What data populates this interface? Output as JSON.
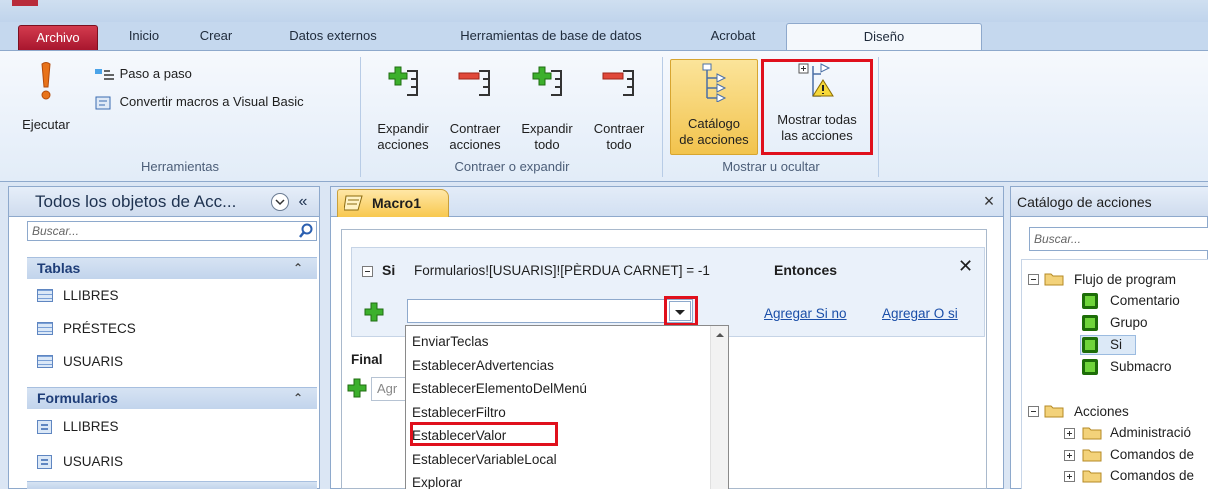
{
  "tabs": {
    "file": "Archivo",
    "home": "Inicio",
    "create": "Crear",
    "external": "Datos externos",
    "dbtools": "Herramientas de base de datos",
    "acrobat": "Acrobat",
    "design": "Diseño"
  },
  "ribbon": {
    "run": "Ejecutar",
    "step": "Paso a paso",
    "convert": "Convertir macros a Visual Basic",
    "tools_group": "Herramientas",
    "expand_actions_1": "Expandir",
    "expand_actions_2": "acciones",
    "collapse_actions_1": "Contraer",
    "collapse_actions_2": "acciones",
    "expand_all_1": "Expandir",
    "expand_all_2": "todo",
    "collapse_all_1": "Contraer",
    "collapse_all_2": "todo",
    "collapse_group": "Contraer o expandir",
    "catalog_1": "Catálogo",
    "catalog_2": "de acciones",
    "show_all_1": "Mostrar todas",
    "show_all_2": "las acciones",
    "show_group": "Mostrar u ocultar"
  },
  "nav": {
    "title": "Todos los objetos de Acc...",
    "collapse": "«",
    "search_placeholder": "Buscar...",
    "groups": [
      {
        "label": "Tablas",
        "items": [
          "LLIBRES",
          "PRÉSTECS",
          "USUARIS"
        ]
      },
      {
        "label": "Formularios",
        "items": [
          "LLIBRES",
          "USUARIS"
        ]
      }
    ]
  },
  "document": {
    "tab": "Macro1",
    "close": "×",
    "if_keyword": "Si",
    "condition": "Formularios![USUARIS]![PÈRDUA CARNET] = -1",
    "then_keyword": "Entonces",
    "add_else": "Agregar Si no",
    "add_else_if": "Agregar O si",
    "final_label": "Final",
    "add_new_placeholder": "Agr",
    "dropdown_items": [
      "EnviarTeclas",
      "EstablecerAdvertencias",
      "EstablecerElementoDelMenú",
      "EstablecerFiltro",
      "EstablecerValor",
      "EstablecerVariableLocal",
      "Explorar"
    ]
  },
  "catalog": {
    "title": "Catálogo de acciones",
    "search_placeholder": "Buscar...",
    "flow_label": "Flujo de program",
    "flow_items": [
      "Comentario",
      "Grupo",
      "Si",
      "Submacro"
    ],
    "actions_label": "Acciones",
    "action_folders": [
      "Administració",
      "Comandos de",
      "Comandos de"
    ]
  },
  "colors": {
    "highlight_red": "#e0101c",
    "file_tab": "#c42a3e",
    "active_button": "#f6d270",
    "link": "#1a4ea8"
  }
}
